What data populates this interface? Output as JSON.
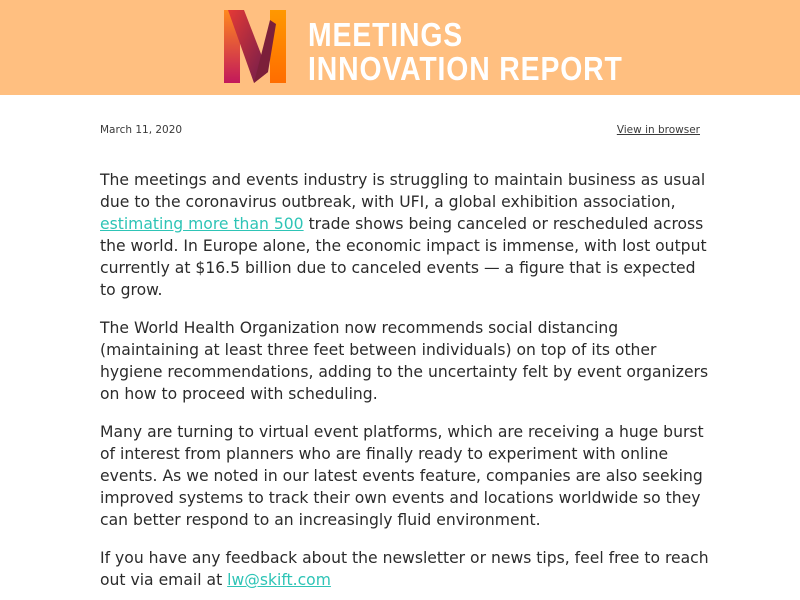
{
  "header": {
    "logo_line1": "MEETINGS",
    "logo_line2": "INNOVATION REPORT",
    "logo_icon": "m-logo-icon",
    "background_color": "#ffbf80"
  },
  "meta": {
    "date": "March 11, 2020",
    "view_in_browser": "View in browser"
  },
  "body": {
    "p1": {
      "before_link": "The meetings and events industry is struggling to maintain business as usual due to the coronavirus outbreak, with UFI, a global exhibition association, ",
      "link": "estimating more than 500",
      "after_link": " trade shows being canceled or rescheduled across the world. In Europe alone, the economic impact is immense, with lost output currently at $16.5 billion due to canceled events — a figure that is expected to grow."
    },
    "p2": "The World Health Organization now recommends social distancing (maintaining at least three feet between individuals) on top of its other hygiene recommendations, adding to the uncertainty felt by event organizers on how to proceed with scheduling.",
    "p3": "Many are turning to virtual event platforms, which are receiving a huge burst of interest from planners who are finally ready to experiment with online events. As we noted in our latest events feature, companies are also seeking improved systems to track their own events and locations worldwide so they can better respond to an increasingly fluid environment.",
    "p4": {
      "before_link": "If you have any feedback about the newsletter or news tips, feel free to reach out via email at ",
      "link": "lw@skift.com"
    },
    "link_color": "#2ec4b6"
  }
}
